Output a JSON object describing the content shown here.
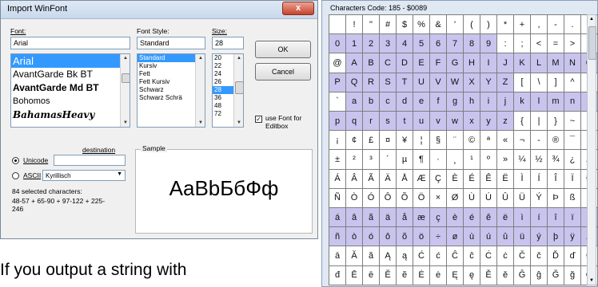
{
  "dialog": {
    "title": "Import WinFont",
    "close_glyph": "x",
    "font_label": "Font:",
    "font_value": "Arial",
    "font_list": [
      "Arial",
      "AvantGarde Bk BT",
      "AvantGarde Md BT",
      "Bohomos",
      "BahamasHeavy"
    ],
    "style_label": "Font Style:",
    "style_value": "Standard",
    "style_list": [
      "Standard",
      "Kursiv",
      "Fett",
      "Fett Kursiv",
      "Schwarz",
      "Schwarz Schrä"
    ],
    "size_label": "Size:",
    "size_value": "28",
    "size_list": [
      "20",
      "22",
      "24",
      "26",
      "28",
      "36",
      "48",
      "72"
    ],
    "ok_label": "OK",
    "cancel_label": "Cancel",
    "use_font_label": "use Font for Editbox",
    "use_font_checked": true,
    "destination_label": "destination",
    "unicode_label": "Unicode",
    "ascii_label": "ASCII",
    "ascii_select": "Kyrillisch",
    "selected_count": "84 selected characters:",
    "ranges": "48-57 + 65-90 + 97-122 + 225-246",
    "sample_label": "Sample",
    "sample_text": "AaBbБбФф"
  },
  "caption": "If you output  a string with",
  "charmap": {
    "title": "Characters  Code: 185 - $0089",
    "rows": [
      [
        " ",
        "!",
        "\"",
        "#",
        "$",
        "%",
        "&",
        "'",
        "(",
        ")",
        "*",
        "+",
        ",",
        "-",
        ".",
        "/"
      ],
      [
        "0",
        "1",
        "2",
        "3",
        "4",
        "5",
        "6",
        "7",
        "8",
        "9",
        ":",
        ";",
        "<",
        "=",
        ">",
        "?"
      ],
      [
        "@",
        "A",
        "B",
        "C",
        "D",
        "E",
        "F",
        "G",
        "H",
        "I",
        "J",
        "K",
        "L",
        "M",
        "N",
        "O"
      ],
      [
        "P",
        "Q",
        "R",
        "S",
        "T",
        "U",
        "V",
        "W",
        "X",
        "Y",
        "Z",
        "[",
        "\\",
        "]",
        "^",
        "_"
      ],
      [
        "`",
        "a",
        "b",
        "c",
        "d",
        "e",
        "f",
        "g",
        "h",
        "i",
        "j",
        "k",
        "l",
        "m",
        "n",
        "o"
      ],
      [
        "p",
        "q",
        "r",
        "s",
        "t",
        "u",
        "v",
        "w",
        "x",
        "y",
        "z",
        "{",
        "|",
        "}",
        "~",
        ""
      ],
      [
        "¡",
        "¢",
        "£",
        "¤",
        "¥",
        "¦",
        "§",
        "¨",
        "©",
        "ª",
        "«",
        "¬",
        "-",
        "®",
        "¯",
        "°"
      ],
      [
        "±",
        "²",
        "³",
        "´",
        "µ",
        "¶",
        "·",
        "¸",
        "¹",
        "º",
        "»",
        "¼",
        "½",
        "¾",
        "¿",
        "À"
      ],
      [
        "Á",
        "Â",
        "Ã",
        "Ä",
        "Å",
        "Æ",
        "Ç",
        "È",
        "É",
        "Ê",
        "Ë",
        "Ì",
        "Í",
        "Î",
        "Ï",
        "Ð"
      ],
      [
        "Ñ",
        "Ò",
        "Ó",
        "Ô",
        "Õ",
        "Ö",
        "×",
        "Ø",
        "Ù",
        "Ú",
        "Û",
        "Ü",
        "Ý",
        "Þ",
        "ß",
        "à"
      ],
      [
        "á",
        "â",
        "ã",
        "ä",
        "å",
        "æ",
        "ç",
        "è",
        "é",
        "ê",
        "ë",
        "ì",
        "í",
        "î",
        "ï",
        "ð"
      ],
      [
        "ñ",
        "ò",
        "ó",
        "ô",
        "õ",
        "ö",
        "÷",
        "ø",
        "ù",
        "ú",
        "û",
        "ü",
        "ý",
        "þ",
        "ÿ",
        "Ā"
      ],
      [
        "ā",
        "Ă",
        "ă",
        "Ą",
        "ą",
        "Ć",
        "ć",
        "Ĉ",
        "ĉ",
        "Ċ",
        "ċ",
        "Č",
        "č",
        "Ď",
        "ď",
        "Đ"
      ],
      [
        "đ",
        "Ē",
        "ē",
        "Ĕ",
        "ĕ",
        "Ė",
        "ė",
        "Ę",
        "ę",
        "Ě",
        "ě",
        "Ĝ",
        "ĝ",
        "Ğ",
        "ğ",
        "Ġ"
      ]
    ],
    "highlight": [
      [
        0,
        0,
        0,
        0,
        0,
        0,
        0,
        0,
        0,
        0,
        0,
        0,
        0,
        0,
        0,
        0
      ],
      [
        1,
        1,
        1,
        1,
        1,
        1,
        1,
        1,
        1,
        1,
        0,
        0,
        0,
        0,
        0,
        0
      ],
      [
        0,
        1,
        1,
        1,
        1,
        1,
        1,
        1,
        1,
        1,
        1,
        1,
        1,
        1,
        1,
        1
      ],
      [
        1,
        1,
        1,
        1,
        1,
        1,
        1,
        1,
        1,
        1,
        1,
        0,
        0,
        0,
        0,
        0
      ],
      [
        0,
        1,
        1,
        1,
        1,
        1,
        1,
        1,
        1,
        1,
        1,
        1,
        1,
        1,
        1,
        1
      ],
      [
        1,
        1,
        1,
        1,
        1,
        1,
        1,
        1,
        1,
        1,
        1,
        0,
        0,
        0,
        0,
        0
      ],
      [
        0,
        0,
        0,
        0,
        0,
        0,
        0,
        0,
        0,
        0,
        0,
        0,
        0,
        0,
        0,
        0
      ],
      [
        0,
        0,
        0,
        0,
        0,
        0,
        0,
        0,
        0,
        0,
        0,
        0,
        0,
        0,
        0,
        0
      ],
      [
        0,
        0,
        0,
        0,
        0,
        0,
        0,
        0,
        0,
        0,
        0,
        0,
        0,
        0,
        0,
        0
      ],
      [
        0,
        0,
        0,
        0,
        0,
        0,
        0,
        0,
        0,
        0,
        0,
        0,
        0,
        0,
        0,
        0
      ],
      [
        1,
        1,
        1,
        1,
        1,
        1,
        1,
        1,
        1,
        1,
        1,
        1,
        1,
        1,
        1,
        1
      ],
      [
        1,
        1,
        1,
        1,
        1,
        1,
        1,
        1,
        1,
        1,
        1,
        1,
        1,
        1,
        1,
        1
      ],
      [
        0,
        0,
        0,
        0,
        0,
        0,
        0,
        0,
        0,
        0,
        0,
        0,
        0,
        0,
        0,
        0
      ],
      [
        0,
        0,
        0,
        0,
        0,
        0,
        0,
        0,
        0,
        0,
        0,
        0,
        0,
        0,
        0,
        0
      ]
    ],
    "highlight_color": "#c8c4ee"
  }
}
